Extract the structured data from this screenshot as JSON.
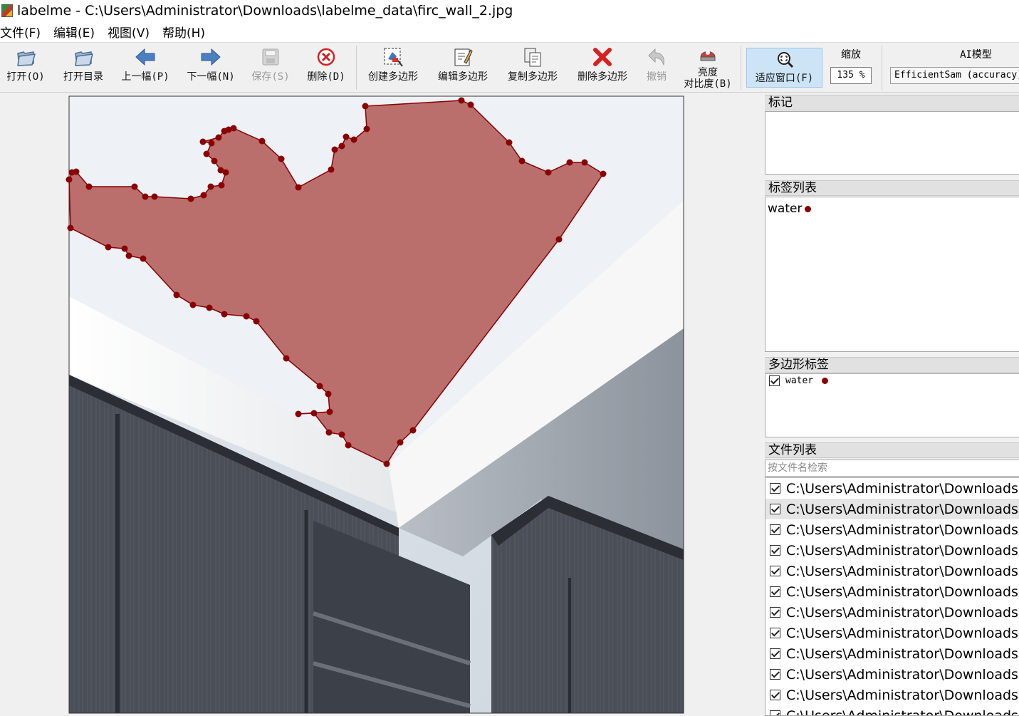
{
  "window": {
    "title": "labelme - C:\\Users\\Administrator\\Downloads\\labelme_data\\firc_wall_2.jpg"
  },
  "menu": [
    "文件(F)",
    "编辑(E)",
    "视图(V)",
    "帮助(H)"
  ],
  "toolbar": {
    "open": "打开(O)",
    "open_dir": "打开目录",
    "prev": "上一幅(P)",
    "next": "下一幅(N)",
    "save": "保存(S)",
    "delete_file": "删除(D)",
    "create_polygon": "创建多边形",
    "edit_polygon": "编辑多边形",
    "copy_polygon": "复制多边形",
    "delete_polygon": "删除多边形",
    "undo": "撤销",
    "brightness_line1": "亮度",
    "brightness_line2": "对比度(B)",
    "fit_window": "适应窗口(F)",
    "zoom_label": "缩放",
    "zoom_value": "135 %",
    "ai_label": "AI模型",
    "ai_model": "EfficientSam (accuracy)"
  },
  "icons": {
    "open": "folder-open-icon",
    "open_dir": "folder-open-icon",
    "prev": "arrow-left-icon",
    "next": "arrow-right-icon",
    "save": "save-icon",
    "delete_file": "delete-circle-icon",
    "create_polygon": "create-polygon-icon",
    "edit_polygon": "edit-polygon-icon",
    "copy_polygon": "copy-polygon-icon",
    "delete_polygon": "delete-polygon-icon",
    "undo": "undo-icon",
    "brightness": "brightness-contrast-icon",
    "fit_window": "fit-window-icon"
  },
  "colors": {
    "polygon_fill": "#a0302c",
    "polygon_vertex": "#8b0000",
    "active_button": "#cde4f7"
  },
  "panels": {
    "flags_title": "标记",
    "label_list_title": "标签列表",
    "label_list_items": [
      "water"
    ],
    "polygon_labels_title": "多边形标签",
    "polygon_labels": [
      {
        "label": "water",
        "checked": true
      }
    ],
    "file_list_title": "文件列表",
    "file_search_placeholder": "按文件名检索",
    "files": [
      {
        "path": "C:\\Users\\Administrator\\Downloads",
        "checked": true,
        "selected": false
      },
      {
        "path": "C:\\Users\\Administrator\\Downloads",
        "checked": true,
        "selected": true
      },
      {
        "path": "C:\\Users\\Administrator\\Downloads",
        "checked": true,
        "selected": false
      },
      {
        "path": "C:\\Users\\Administrator\\Downloads",
        "checked": true,
        "selected": false
      },
      {
        "path": "C:\\Users\\Administrator\\Downloads",
        "checked": true,
        "selected": false
      },
      {
        "path": "C:\\Users\\Administrator\\Downloads",
        "checked": true,
        "selected": false
      },
      {
        "path": "C:\\Users\\Administrator\\Downloads",
        "checked": true,
        "selected": false
      },
      {
        "path": "C:\\Users\\Administrator\\Downloads",
        "checked": true,
        "selected": false
      },
      {
        "path": "C:\\Users\\Administrator\\Downloads",
        "checked": true,
        "selected": false
      },
      {
        "path": "C:\\Users\\Administrator\\Downloads",
        "checked": true,
        "selected": false
      },
      {
        "path": "C:\\Users\\Administrator\\Downloads",
        "checked": true,
        "selected": false
      },
      {
        "path": "C:\\Users\\Administrator\\Downloads",
        "checked": true,
        "selected": false
      }
    ]
  }
}
